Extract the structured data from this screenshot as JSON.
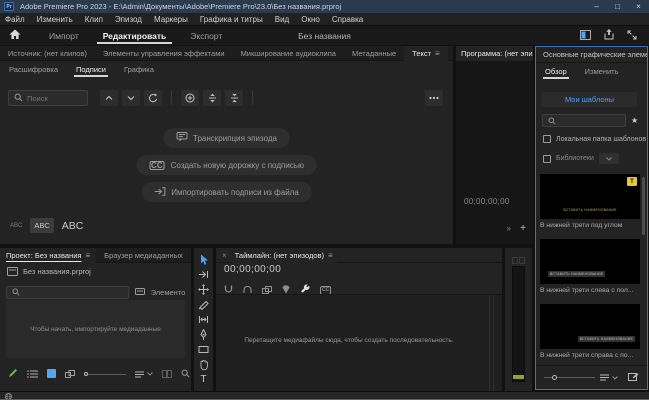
{
  "titlebar": {
    "logo": "Pr",
    "title": "Adobe Premiere Pro 2023 - E:\\Admin\\Документы\\Adobe\\Premiere Pro\\23.0\\Без названия.prproj",
    "minimize": "–",
    "maximize": "□",
    "close": "×"
  },
  "menubar": {
    "items": [
      "Файл",
      "Изменить",
      "Клип",
      "Эпизод",
      "Маркеры",
      "Графика и титры",
      "Вид",
      "Окно",
      "Справка"
    ]
  },
  "workspace": {
    "tabs": [
      "Импорт",
      "Редактировать",
      "Экспорт"
    ],
    "project_name": "Без названия"
  },
  "text_panel": {
    "tabs": [
      "Источник: (нет клипов)",
      "Элементы управления эффектами",
      "Микширование аудиоклипа",
      "Метаданные",
      "Текст"
    ],
    "panel_menu": "≡",
    "subtabs": [
      "Расшифровка",
      "Подписи",
      "Графика"
    ],
    "search_placeholder": "Поиск",
    "actions": [
      "Транскрипция эпизода",
      "Создать новую дорожку с подписью",
      "Импортировать подписи из файла"
    ],
    "cc_glyph": "CC",
    "sizes": [
      "ABC",
      "ABC",
      "ABC"
    ]
  },
  "program_panel": {
    "title": "Программа: (нет эпизо",
    "timecode": "00;00;00;00",
    "overflow": "»",
    "add_button": "+"
  },
  "essential_graphics": {
    "title": "Основные графические элементы",
    "tabs": [
      "Обзор",
      "Изменить"
    ],
    "my_templates_label": "Мои шаблоны",
    "favorites_star": "★",
    "local_folder_label": "Локальная папка шаблонов",
    "libraries_label": "Библиотеки",
    "templates": [
      {
        "label": "В нижней трети под углом",
        "thumb_text": "ВСТАВИТЬ НАИМЕНОВАНИЕ",
        "badge": "T"
      },
      {
        "label": "В нижней трети слева с пол...",
        "thumb_text": "ВСТАВИТЬ НАИМЕНОВАНИЕ"
      },
      {
        "label": "В нижней трети справа с по...",
        "thumb_text": "ВСТАВИТЬ НАИМЕНОВАНИЕ"
      }
    ]
  },
  "project_panel": {
    "tabs": [
      "Проект: Без названия",
      "Браузер медиаданных"
    ],
    "overflow": "»",
    "panel_menu": "≡",
    "file_name": "Без названия.prproj",
    "items_count_label": "Элементо...",
    "empty_message": "Чтобы начать, импортируйте медиаданные"
  },
  "tools": {
    "type_tool_label": "T"
  },
  "timeline_panel": {
    "close": "×",
    "title": "Таймлайн: (нет эпизодов)",
    "panel_menu": "≡",
    "timecode": "00;00;00;00",
    "cc_badge": "CC",
    "empty_message": "Перетащите медиафайлы сюда, чтобы создать последовательность."
  },
  "colors": {
    "accent_blue": "#2d8ceb",
    "focus_border": "#3f72b8",
    "link_blue": "#4b9fff",
    "tool_active": "#4aa3ff",
    "pencil_green": "#6abf4b",
    "template_badge": "#e6c832",
    "meter_level": "#9aa02e"
  }
}
